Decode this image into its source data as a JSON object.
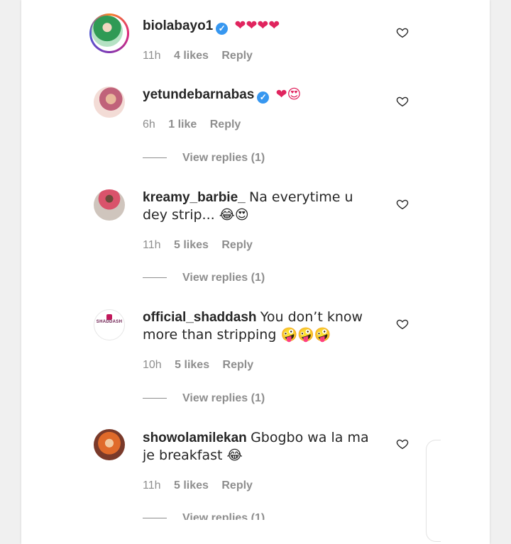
{
  "colors": {
    "text": "#262626",
    "secondary": "#8e8e8e",
    "verified": "#3797f0",
    "heart": "#e0245e"
  },
  "comments": [
    {
      "user": "biolabayo1",
      "verified": true,
      "text": "❤❤❤❤",
      "time": "11h",
      "likes": "4 likes",
      "reply": "Reply",
      "view_replies": ""
    },
    {
      "user": "yetundebarnabas",
      "verified": true,
      "text": "❤😍",
      "time": "6h",
      "likes": "1 like",
      "reply": "Reply",
      "view_replies": "View replies (1)"
    },
    {
      "user": "kreamy_barbie_",
      "verified": false,
      "text": "Na everytime u dey strip... 😂😍",
      "time": "11h",
      "likes": "5 likes",
      "reply": "Reply",
      "view_replies": "View replies (1)"
    },
    {
      "user": "official_shaddash",
      "verified": false,
      "text": "You don’t know more than stripping 🤪🤪🤪",
      "time": "10h",
      "likes": "5 likes",
      "reply": "Reply",
      "view_replies": "View replies (1)"
    },
    {
      "user": "showolamilekan",
      "verified": false,
      "text": "Gbogbo wa la ma je breakfast 😂",
      "time": "11h",
      "likes": "5 likes",
      "reply": "Reply",
      "view_replies": "View replies (1)"
    }
  ],
  "shaddash_logo_text": "SHADDASH",
  "icons": {
    "like": "heart-outline-icon",
    "verified": "verified-badge-icon"
  }
}
